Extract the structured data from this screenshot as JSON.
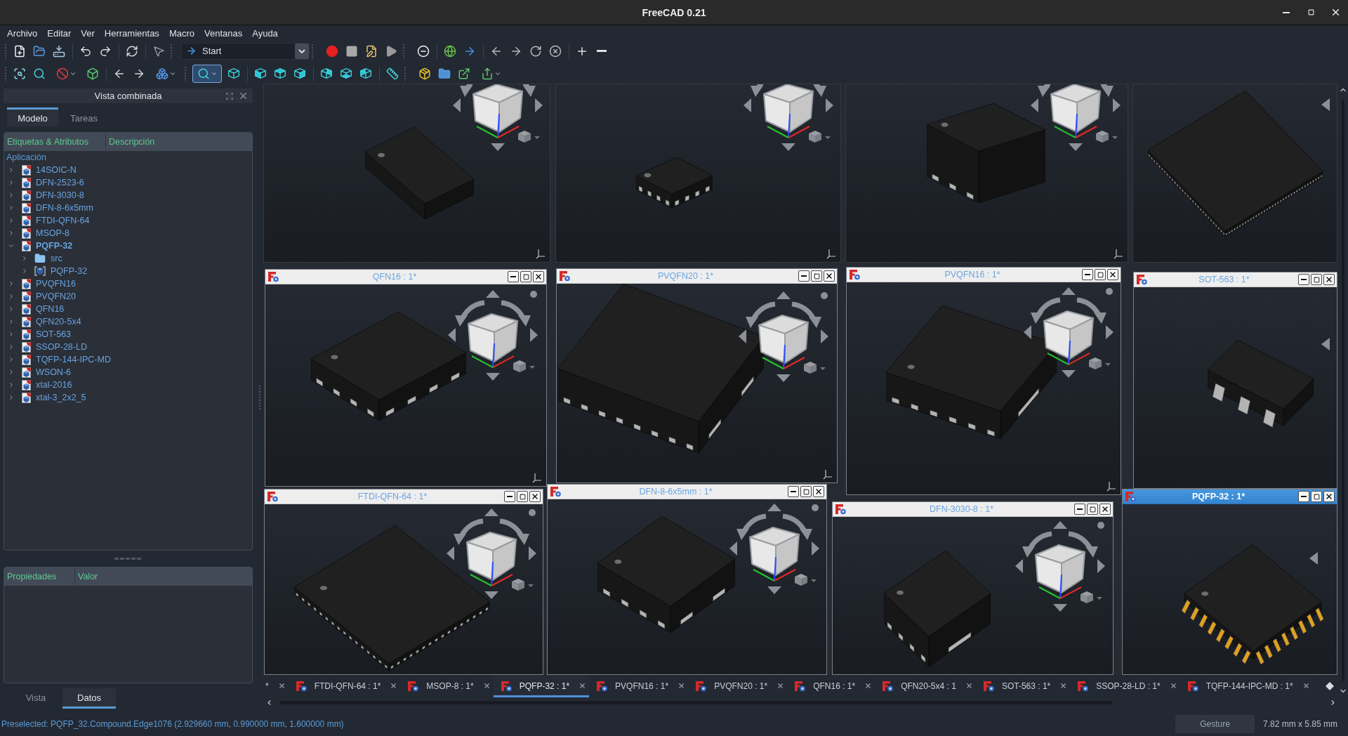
{
  "window": {
    "title": "FreeCAD 0.21"
  },
  "menu": [
    "Archivo",
    "Editar",
    "Ver",
    "Herramientas",
    "Macro",
    "Ventanas",
    "Ayuda"
  ],
  "toolbars": {
    "workbench": "Start",
    "selection_tool": {
      "checked": true
    }
  },
  "combo_view": {
    "title": "Vista combinada",
    "tabs": [
      {
        "label": "Modelo",
        "selected": true
      },
      {
        "label": "Tareas",
        "selected": false
      }
    ],
    "tree": {
      "columns": [
        "Etiquetas & Atributos",
        "Descripción"
      ],
      "root": "Aplicación",
      "items": [
        {
          "label": "14SOIC-N",
          "kind": "document",
          "expanded": false,
          "active": false
        },
        {
          "label": "DFN-2523-6",
          "kind": "document",
          "expanded": false,
          "active": false
        },
        {
          "label": "DFN-3030-8",
          "kind": "document",
          "expanded": false,
          "active": false
        },
        {
          "label": "DFN-8-6x5mm",
          "kind": "document",
          "expanded": false,
          "active": false
        },
        {
          "label": "FTDI-QFN-64",
          "kind": "document",
          "expanded": false,
          "active": false
        },
        {
          "label": "MSOP-8",
          "kind": "document",
          "expanded": false,
          "active": false
        },
        {
          "label": "PQFP-32",
          "kind": "document",
          "expanded": true,
          "active": true,
          "children": [
            {
              "label": "src",
              "kind": "folder",
              "expanded": false
            },
            {
              "label": "PQFP-32",
              "kind": "part",
              "expanded": false
            }
          ]
        },
        {
          "label": "PVQFN16",
          "kind": "document",
          "expanded": false,
          "active": false
        },
        {
          "label": "PVQFN20",
          "kind": "document",
          "expanded": false,
          "active": false
        },
        {
          "label": "QFN16",
          "kind": "document",
          "expanded": false,
          "active": false
        },
        {
          "label": "QFN20-5x4",
          "kind": "document",
          "expanded": false,
          "active": false
        },
        {
          "label": "SOT-563",
          "kind": "document",
          "expanded": false,
          "active": false
        },
        {
          "label": "SSOP-28-LD",
          "kind": "document",
          "expanded": false,
          "active": false
        },
        {
          "label": "TQFP-144-IPC-MD",
          "kind": "document",
          "expanded": false,
          "active": false
        },
        {
          "label": "WSON-6",
          "kind": "document",
          "expanded": false,
          "active": false
        },
        {
          "label": "xtal-2016",
          "kind": "document",
          "expanded": false,
          "active": false
        },
        {
          "label": "xtal-3_2x2_5",
          "kind": "document",
          "expanded": false,
          "active": false
        }
      ]
    },
    "property_columns": [
      "Propiedades",
      "Valor"
    ],
    "property_tabs": [
      {
        "label": "Vista",
        "selected": false
      },
      {
        "label": "Datos",
        "selected": true
      }
    ]
  },
  "subwindows": [
    {
      "title": "QFN16 : 1*",
      "active": false
    },
    {
      "title": "PVQFN20 : 1*",
      "active": false
    },
    {
      "title": "PVQFN16 : 1*",
      "active": false
    },
    {
      "title": "SOT-563 : 1*",
      "active": false
    },
    {
      "title": "FTDI-QFN-64 : 1*",
      "active": false
    },
    {
      "title": "DFN-8-6x5mm : 1*",
      "active": false
    },
    {
      "title": "DFN-3030-8 : 1*",
      "active": false
    },
    {
      "title": "PQFP-32 : 1*",
      "active": true
    }
  ],
  "document_tabs": [
    {
      "label": "*",
      "selected": false,
      "clipped": true
    },
    {
      "label": "FTDI-QFN-64 : 1*",
      "selected": false,
      "clipped": false
    },
    {
      "label": "MSOP-8 : 1*",
      "selected": false,
      "clipped": false
    },
    {
      "label": "PQFP-32 : 1*",
      "selected": true,
      "clipped": false
    },
    {
      "label": "PVQFN16 : 1*",
      "selected": false,
      "clipped": false
    },
    {
      "label": "PVQFN20 : 1*",
      "selected": false,
      "clipped": false
    },
    {
      "label": "QFN16 : 1*",
      "selected": false,
      "clipped": false
    },
    {
      "label": "QFN20-5x4 : 1",
      "selected": false,
      "clipped": false
    },
    {
      "label": "SOT-563 : 1*",
      "selected": false,
      "clipped": false
    },
    {
      "label": "SSOP-28-LD : 1*",
      "selected": false,
      "clipped": false
    },
    {
      "label": "TQFP-144-IPC-MD : 1*",
      "selected": false,
      "clipped": false
    }
  ],
  "status_bar": {
    "message": "Preselected: PQFP_32.Compound.Edge1076 (2.929660 mm, 0.990000 mm, 1.600000 mm)",
    "navigation": "Gesture",
    "dimensions": "7.82 mm x 5.85 mm"
  }
}
